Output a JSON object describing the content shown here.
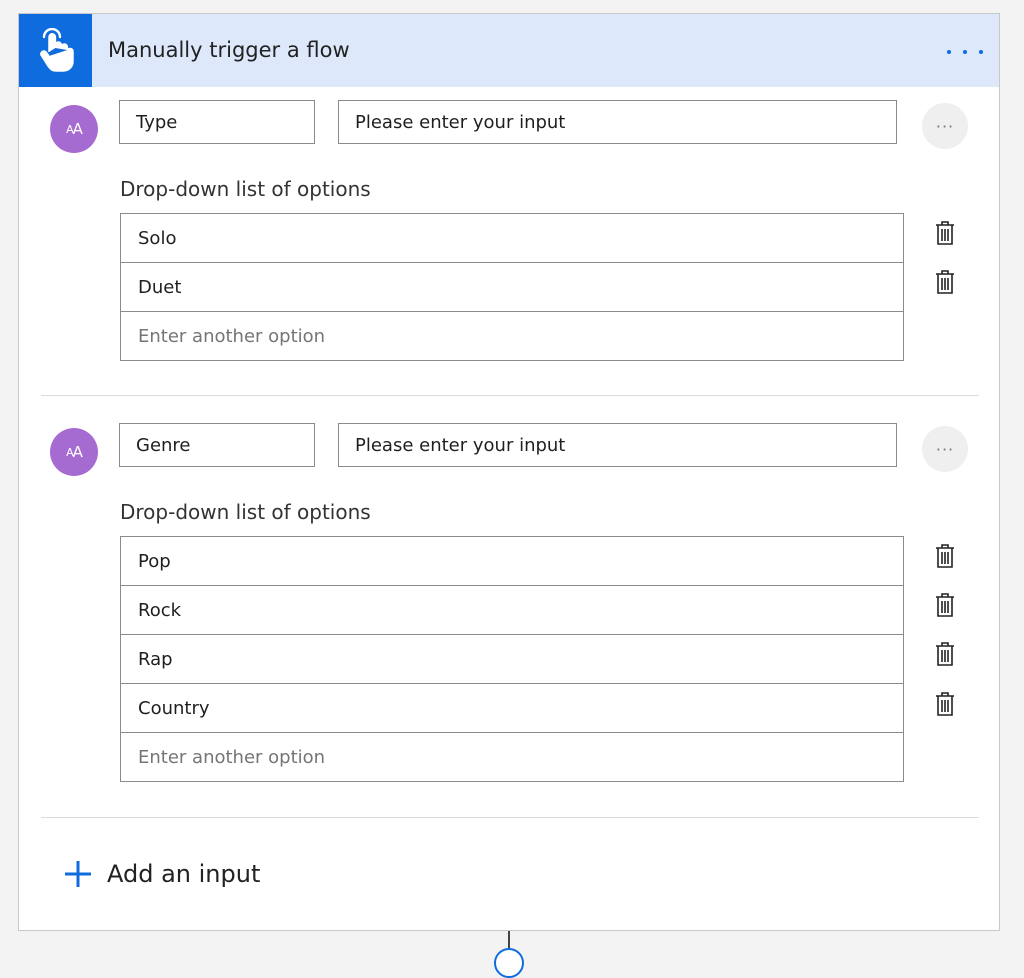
{
  "trigger": {
    "title": "Manually trigger a flow",
    "icon": "touch-hand-icon",
    "more_icon": "ellipsis-icon"
  },
  "inputs": [
    {
      "avatar_text": "AA",
      "name": "Type",
      "prompt": "Please enter your input",
      "options_label": "Drop-down list of options",
      "options": [
        "Solo",
        "Duet"
      ],
      "option_placeholder": "Enter another option"
    },
    {
      "avatar_text": "AA",
      "name": "Genre",
      "prompt": "Please enter your input",
      "options_label": "Drop-down list of options",
      "options": [
        "Pop",
        "Rock",
        "Rap",
        "Country"
      ],
      "option_placeholder": "Enter another option"
    }
  ],
  "add_input_label": "Add an input",
  "colors": {
    "header_bg": "#dde9fb",
    "accent": "#0f6cde",
    "avatar": "#a66bd1"
  }
}
